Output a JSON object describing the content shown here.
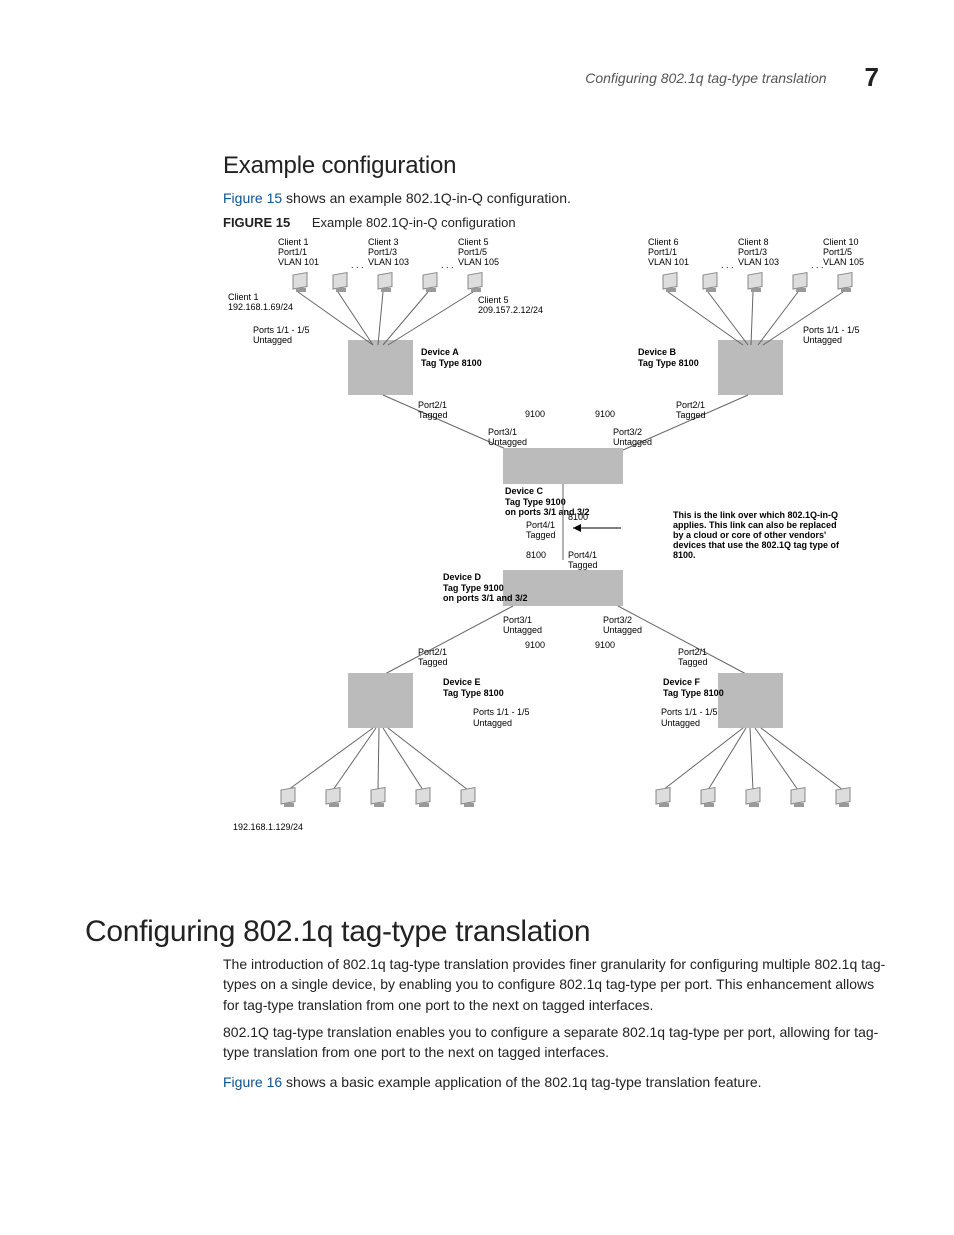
{
  "header": {
    "running_title": "Configuring 802.1q tag-type translation",
    "chapter_number": "7"
  },
  "section": {
    "heading": "Example configuration",
    "intro_link": "Figure 15",
    "intro_rest": " shows an example 802.1Q-in-Q configuration.",
    "figure_label": "FIGURE 15",
    "figure_title": "Example 802.1Q-in-Q configuration"
  },
  "figure": {
    "top_clients_left": [
      {
        "name": "Client 1",
        "port": "Port1/1",
        "vlan": "VLAN 101"
      },
      {
        "name": "Client 3",
        "port": "Port1/3",
        "vlan": "VLAN 103"
      },
      {
        "name": "Client 5",
        "port": "Port1/5",
        "vlan": "VLAN 105"
      }
    ],
    "top_clients_right": [
      {
        "name": "Client 6",
        "port": "Port1/1",
        "vlan": "VLAN 101"
      },
      {
        "name": "Client 8",
        "port": "Port1/3",
        "vlan": "VLAN 103"
      },
      {
        "name": "Client 10",
        "port": "Port1/5",
        "vlan": "VLAN 105"
      }
    ],
    "client1_ip_label": "Client 1",
    "client1_ip": "192.168.1.69/24",
    "client5_ip_label": "Client 5",
    "client5_ip": "209.157.2.12/24",
    "ports_untagged_left": "Ports 1/1 - 1/5",
    "ports_untagged_left2": "Untagged",
    "ports_untagged_right": "Ports 1/1 - 1/5",
    "ports_untagged_right2": "Untagged",
    "device_a": "Device A",
    "device_a_tag": "Tag Type 8100",
    "device_b": "Device B",
    "device_b_tag": "Tag Type 8100",
    "port21_tagged": "Port2/1",
    "port21_tagged2": "Tagged",
    "val_9100": "9100",
    "port31_untagged": "Port3/1",
    "port31_untagged2": "Untagged",
    "port32_untagged": "Port3/2",
    "port32_untagged2": "Untagged",
    "device_c": "Device C",
    "device_c_tag": "Tag Type 9100",
    "device_c_ports": "on ports 3/1 and 3/2",
    "port41_tagged": "Port4/1",
    "port41_tagged2": "Tagged",
    "val_8100": "8100",
    "note1": "This is the link over which 802.1Q-in-Q",
    "note2": "applies. This link can also be replaced",
    "note3": "by a cloud or core of other vendors'",
    "note4": "devices that use the 802.1Q tag type of",
    "note5": "8100.",
    "device_d": "Device D",
    "device_d_tag": "Tag Type 9100",
    "device_d_ports": "on ports 3/1 and 3/2",
    "device_e": "Device E",
    "device_e_tag": "Tag Type 8100",
    "device_f": "Device F",
    "device_f_tag": "Tag Type 8100",
    "ports_e": "Ports 1/1 - 1/5",
    "ports_e2": "Untagged",
    "ports_f": "Ports 1/1 - 1/5",
    "ports_f2": "Untagged",
    "bottom_ip": "192.168.1.129/24"
  },
  "main": {
    "heading": "Configuring 802.1q tag-type translation",
    "p1": "The introduction of 802.1q tag-type translation provides finer granularity for configuring multiple 802.1q tag-types on a single device, by enabling you to configure 802.1q tag-type per port. This enhancement allows for tag-type translation from one port to the next on tagged interfaces.",
    "p2": "802.1Q tag-type translation enables you to configure a separate 802.1q tag-type per port, allowing for tag-type translation from one port to the next on tagged interfaces.",
    "p3_link": "Figure 16",
    "p3_rest": " shows a basic example application of the 802.1q tag-type translation feature."
  }
}
